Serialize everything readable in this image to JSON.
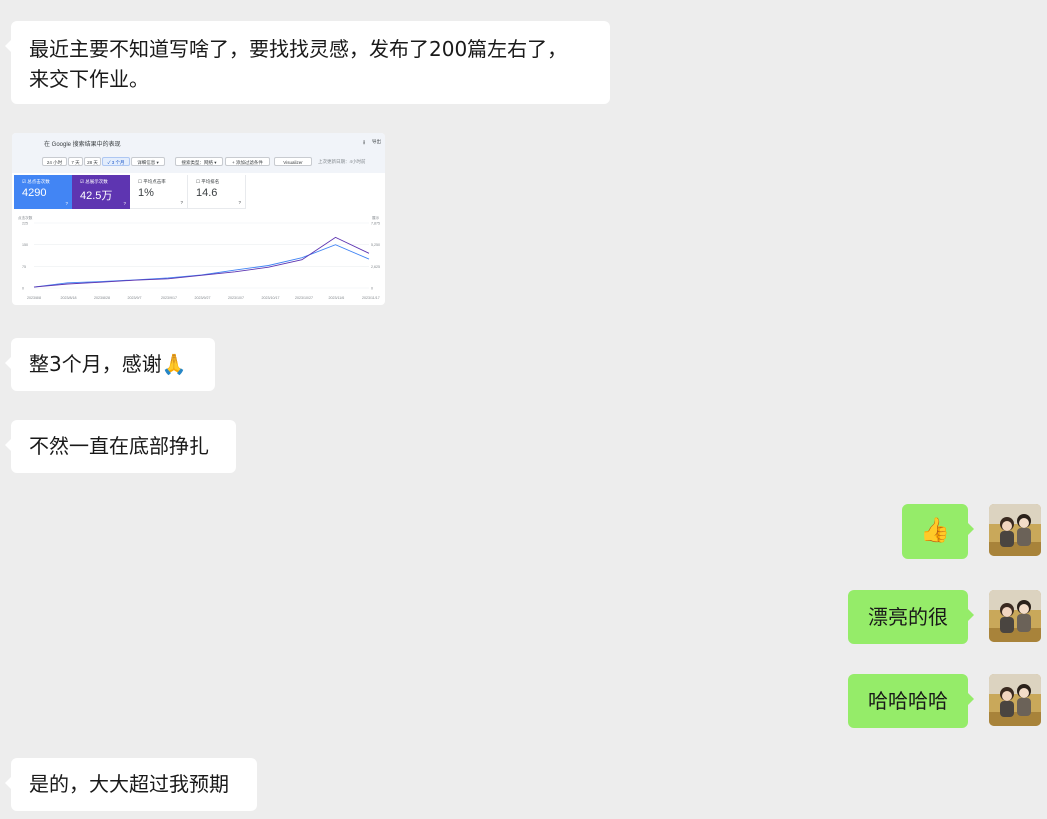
{
  "messages": {
    "m1_line1": "最近主要不知道写啥了，要找找灵感，发布了200篇左右了，",
    "m1_line2": "来交下作业。",
    "m3": "整3个月，感谢🙏",
    "m4": "不然一直在底部挣扎",
    "m5": "👍",
    "m6": "漂亮的很",
    "m7": "哈哈哈哈",
    "m8": "是的，大大超过我预期"
  },
  "screenshot": {
    "title": "在 Google 搜索结果中的表现",
    "export": "导出",
    "chips": [
      "24 小时",
      "7 天",
      "28 天",
      "✓ 3 个月",
      "详细信息 ▾",
      "搜索类型：网络 ▾",
      "+ 添加过滤条件",
      "Visualizer"
    ],
    "updated": "上次更新日期：4小时前",
    "metrics": [
      {
        "label": "☑ 总点击次数",
        "value": "4290"
      },
      {
        "label": "☑ 总展示次数",
        "value": "42.5万"
      },
      {
        "label": "☐ 平均点击率",
        "value": "1%"
      },
      {
        "label": "☐ 平均排名",
        "value": "14.6"
      }
    ],
    "chart_left_title": "点击次数",
    "chart_right_title": "展示",
    "left_ticks": [
      "225",
      "150",
      "75",
      "0"
    ],
    "right_ticks": [
      "7,875",
      "5,250",
      "2,625",
      "0"
    ],
    "x_ticks": [
      "2023/8/8",
      "2023/8/18",
      "2023/8/28",
      "2023/9/7",
      "2023/9/17",
      "2023/9/27",
      "2023/10/7",
      "2023/10/17",
      "2023/10/27",
      "2023/11/6",
      "2023/11/17"
    ]
  },
  "chart_data": {
    "type": "line",
    "x": [
      "2023/8/8",
      "2023/8/18",
      "2023/8/28",
      "2023/9/7",
      "2023/9/17",
      "2023/9/27",
      "2023/10/7",
      "2023/10/17",
      "2023/10/27",
      "2023/11/6",
      "2023/11/17"
    ],
    "series": [
      {
        "name": "点击次数",
        "values": [
          3,
          18,
          22,
          28,
          35,
          45,
          62,
          78,
          105,
          150,
          100
        ]
      },
      {
        "name": "展示",
        "values": [
          3,
          14,
          20,
          27,
          32,
          44,
          56,
          72,
          98,
          175,
          120
        ]
      }
    ],
    "ylim": [
      0,
      225
    ]
  },
  "colors": {
    "background": "#ededed",
    "left_bubble": "#ffffff",
    "right_bubble": "#95ec69",
    "clicks_line": "#4285f4",
    "impressions_line": "#5e35b1"
  }
}
